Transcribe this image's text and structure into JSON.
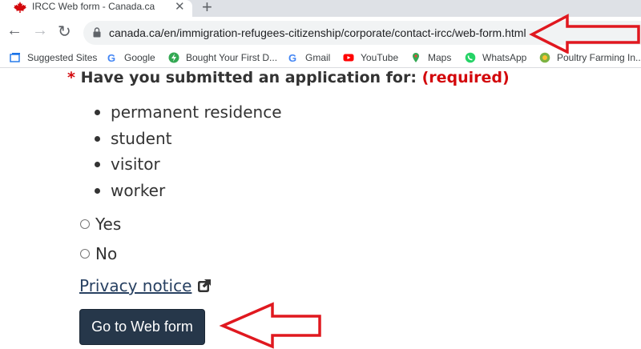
{
  "browser": {
    "tab_title": "IRCC Web form - Canada.ca",
    "tab_close": "✕",
    "new_tab": "+",
    "url": "canada.ca/en/immigration-refugees-citizenship/corporate/contact-ircc/web-form.html",
    "bookmarks": [
      {
        "label": "Suggested Sites",
        "icon": "suggested-sites-icon",
        "color": "#1a73e8"
      },
      {
        "label": "Google",
        "icon": "google-icon",
        "color": "#4285f4"
      },
      {
        "label": "Bought Your First D...",
        "icon": "bought-first-icon",
        "color": "#34a853"
      },
      {
        "label": "Gmail",
        "icon": "gmail-icon",
        "color": "#4285f4"
      },
      {
        "label": "YouTube",
        "icon": "youtube-icon",
        "color": "#ff0000"
      },
      {
        "label": "Maps",
        "icon": "maps-icon",
        "color": "#34a853"
      },
      {
        "label": "WhatsApp",
        "icon": "whatsapp-icon",
        "color": "#25d366"
      },
      {
        "label": "Poultry Farming In...",
        "icon": "poultry-icon",
        "color": "#7cb342"
      }
    ]
  },
  "form": {
    "required_star": "*",
    "question": "Have you submitted an application for:",
    "required_label": "(required)",
    "application_types": [
      "permanent residence",
      "student",
      "visitor",
      "worker"
    ],
    "options": [
      "Yes",
      "No"
    ],
    "privacy_link": "Privacy notice",
    "submit_button": "Go to Web form"
  },
  "colors": {
    "annotation_arrow": "#e0181f",
    "button_bg": "#26374a",
    "link": "#284162",
    "required": "#d3080c"
  }
}
